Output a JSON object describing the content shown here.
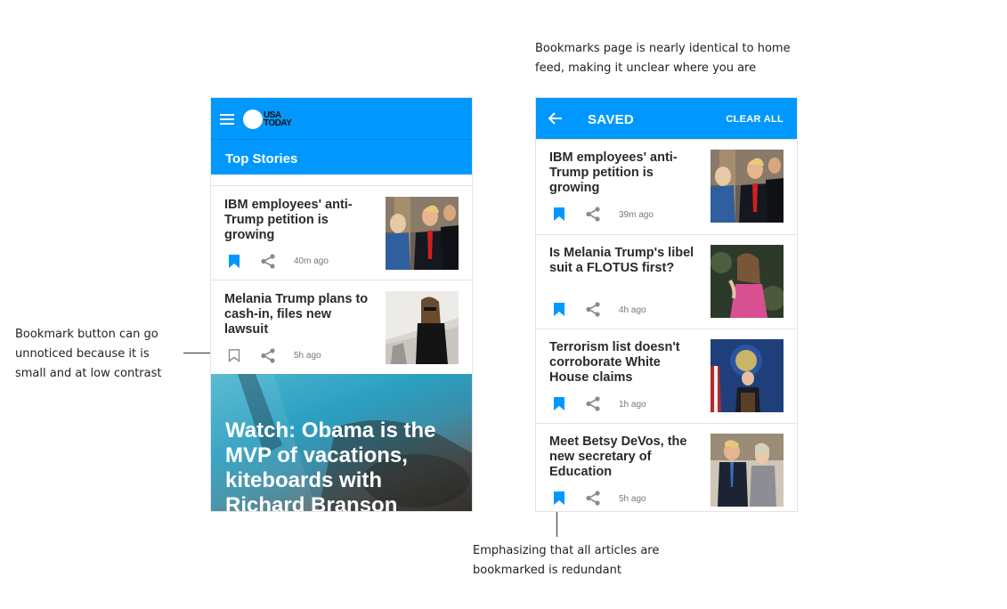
{
  "annotations": {
    "top_right": "Bookmarks page is nearly identical to home feed, making it unclear where you are",
    "left": "Bookmark button can go unnoticed because it is small and at low contrast",
    "bottom": "Emphasizing that all articles are bookmarked is redundant"
  },
  "home": {
    "logo_line1": "USA",
    "logo_line2": "TODAY",
    "section_title": "Top Stories",
    "articles": [
      {
        "headline": "IBM employees' anti-Trump petition is growing",
        "time": "40m ago",
        "bookmarked": true
      },
      {
        "headline": "Melania Trump plans to cash-in, files new lawsuit",
        "time": "5h ago",
        "bookmarked": false
      }
    ],
    "hero_headline": "Watch: Obama is the MVP of vacations, kiteboards with Richard Branson"
  },
  "saved": {
    "title": "SAVED",
    "clear_all": "CLEAR ALL",
    "articles": [
      {
        "headline": "IBM employees' anti-Trump petition is growing",
        "time": "39m ago"
      },
      {
        "headline": "Is Melania Trump's libel suit a FLOTUS first?",
        "time": "4h ago"
      },
      {
        "headline": "Terrorism list doesn't corroborate White House claims",
        "time": "1h ago"
      },
      {
        "headline": "Meet Betsy DeVos, the new secretary of Education",
        "time": "5h ago"
      }
    ]
  },
  "colors": {
    "brand_blue": "#0098fe",
    "bookmark_active": "#0098fe",
    "icon_gray": "#8a8a8a"
  },
  "icons": [
    "hamburger-icon",
    "back-arrow-icon",
    "bookmark-icon",
    "share-icon"
  ]
}
